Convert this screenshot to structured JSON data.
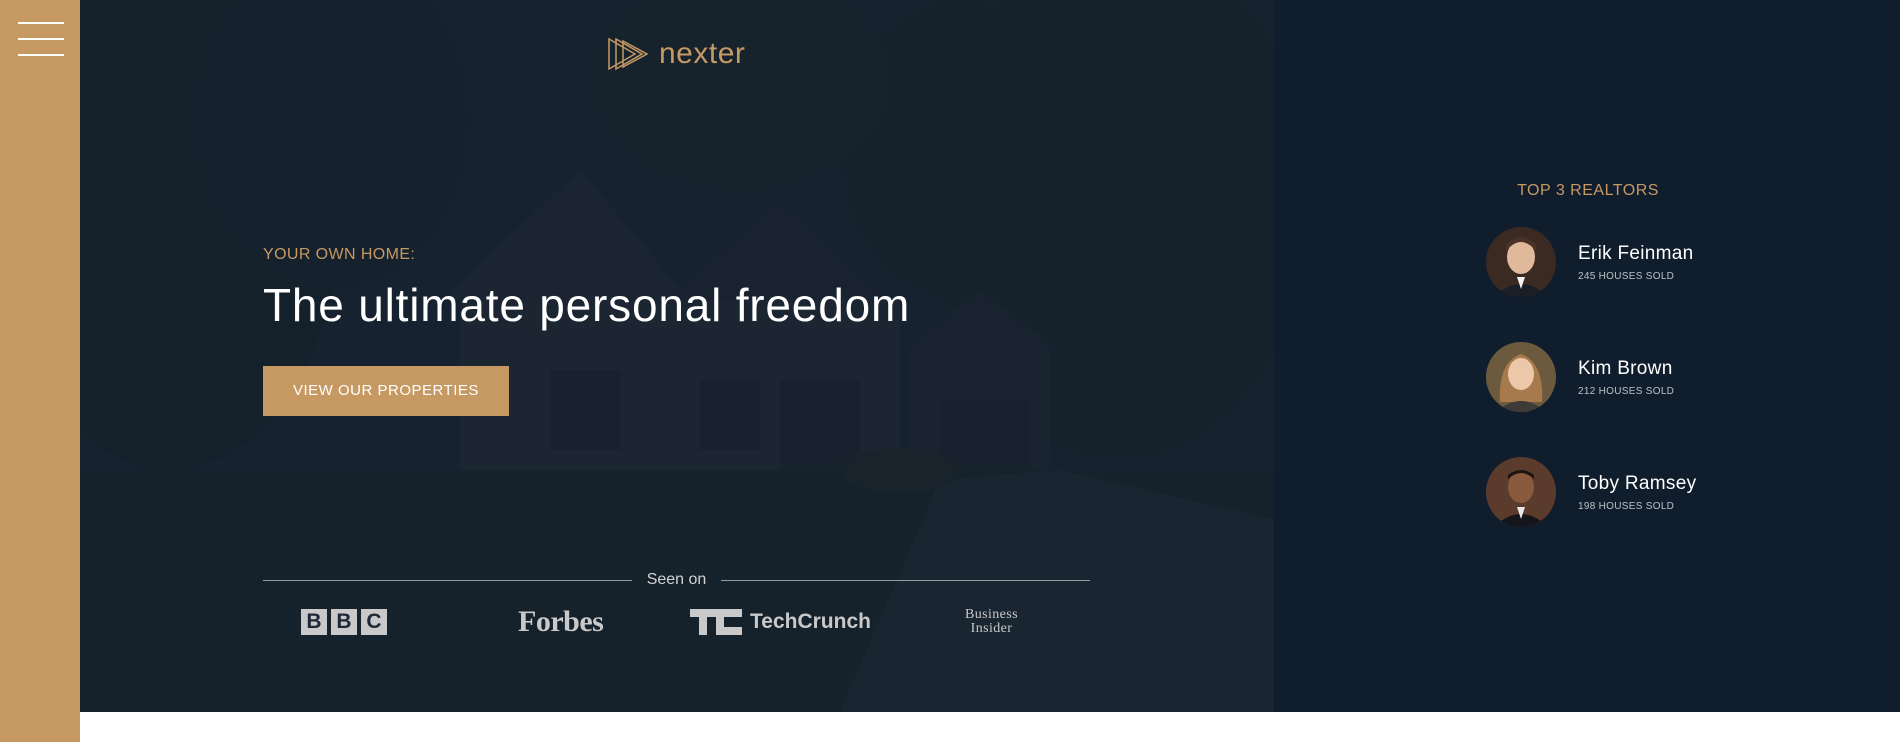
{
  "brand": {
    "name": "nexter",
    "accent_color": "#c69963",
    "dark_color": "#101d2c"
  },
  "sidebar": {
    "menu_icon": "hamburger-menu-icon"
  },
  "hero": {
    "eyebrow": "YOUR OWN HOME:",
    "headline": "The ultimate personal freedom",
    "cta_label": "VIEW OUR PROPERTIES",
    "seen_on_label": "Seen on",
    "press_logos": {
      "bbc": [
        "B",
        "B",
        "C"
      ],
      "forbes": "Forbes",
      "techcrunch": "TechCrunch",
      "business_insider": [
        "Business",
        "Insider"
      ]
    }
  },
  "realtors": {
    "title": "TOP 3 REALTORS",
    "items": [
      {
        "name": "Erik Feinman",
        "sold": "245 HOUSES SOLD"
      },
      {
        "name": "Kim Brown",
        "sold": "212 HOUSES SOLD"
      },
      {
        "name": "Toby Ramsey",
        "sold": "198 HOUSES SOLD"
      }
    ]
  }
}
